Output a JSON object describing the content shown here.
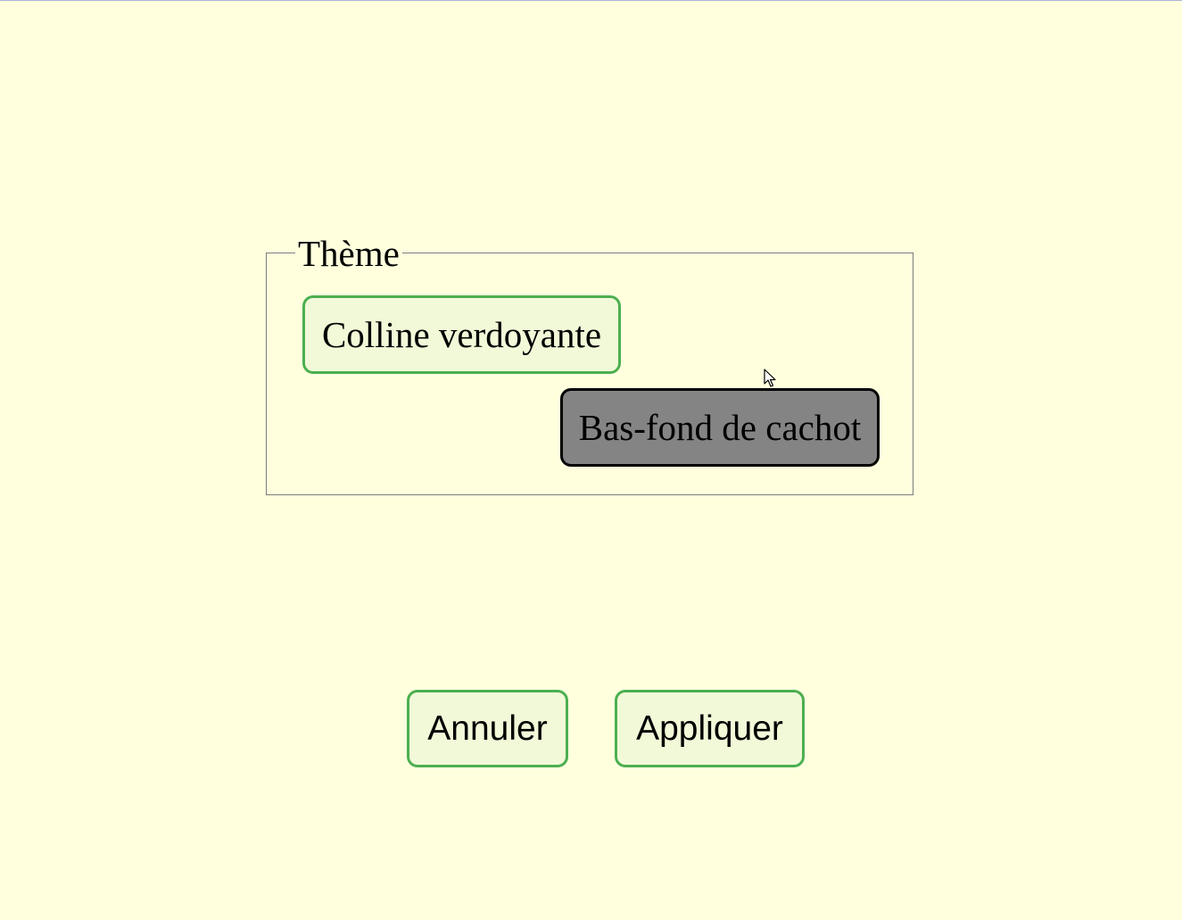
{
  "theme": {
    "legend": "Thème",
    "options": [
      {
        "label": "Colline verdoyante",
        "selected": false
      },
      {
        "label": "Bas-fond de cachot",
        "selected": true
      }
    ]
  },
  "actions": {
    "cancel_label": "Annuler",
    "apply_label": "Appliquer"
  },
  "colors": {
    "background": "#ffffde",
    "button_fill": "#f1f9d8",
    "button_border": "#4caf50",
    "selected_fill": "#848484",
    "selected_border": "#000000"
  },
  "cursor": {
    "icon": "mouse-pointer-icon"
  }
}
